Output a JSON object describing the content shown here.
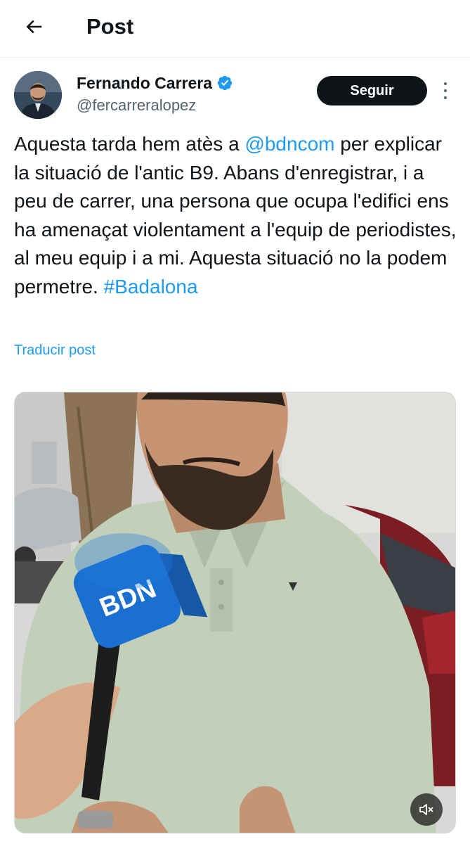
{
  "header": {
    "title": "Post",
    "back_icon": "arrow-left-icon"
  },
  "author": {
    "name": "Fernando Carrera",
    "handle": "@fercarreralopez",
    "verified_icon": "verified-badge-icon",
    "verified_color": "#1d9bf0"
  },
  "actions": {
    "follow_label": "Seguir",
    "more_icon": "more-vertical-icon"
  },
  "post": {
    "text_part1": "Aquesta tarda hem atès a ",
    "mention": "@bdncom",
    "text_part2": " per explicar la situació de l'antic B9. Abans d'enregistrar, i a peu de carrer, una persona que ocupa l'edifici ens ha amenaçat violentament a l'equip de periodistes, al meu equip i a mi. Aquesta situació no la podem permetre. ",
    "hashtag": "#Badalona",
    "translate_label": "Traducir post"
  },
  "media": {
    "microphone_logo": "BDN",
    "mute_icon": "volume-muted-icon"
  },
  "colors": {
    "accent": "#1d9bf0",
    "text": "#0f1419",
    "secondary": "#536471"
  }
}
